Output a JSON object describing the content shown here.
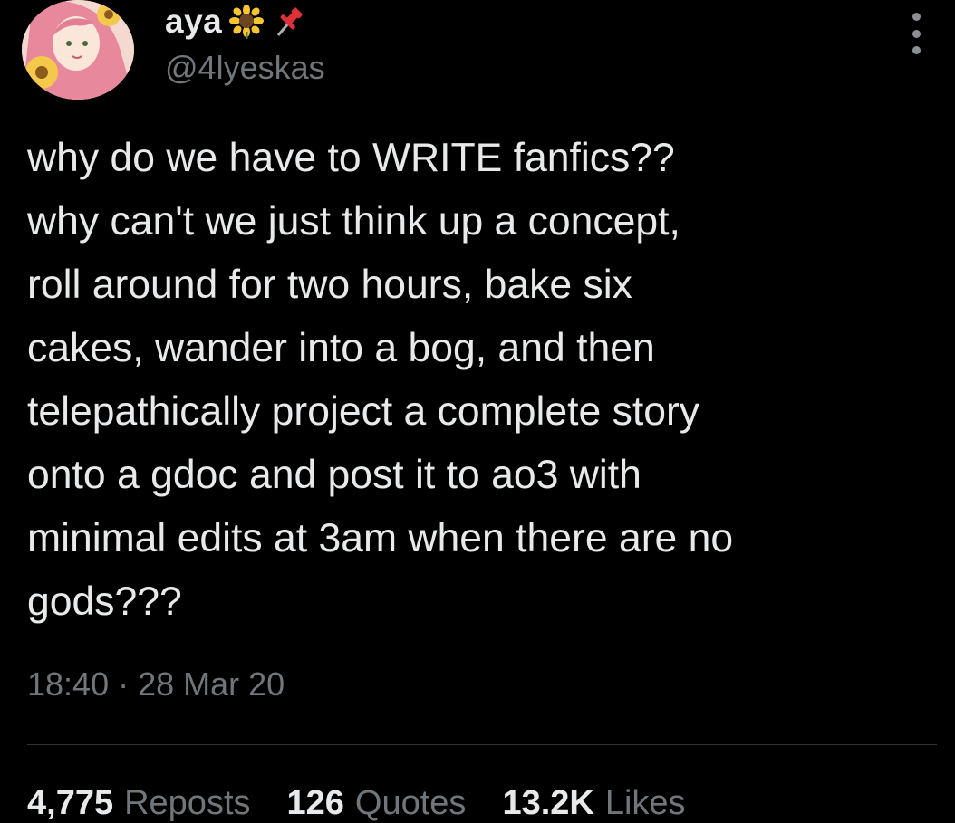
{
  "author": {
    "display_name": "aya",
    "handle": "@4lyeskas",
    "name_emojis": [
      "sunflower-emoji",
      "pushpin-emoji"
    ]
  },
  "tweet": {
    "text": "why do we have to WRITE fanfics??\nwhy can't we just think up a concept,\nroll around for two hours, bake six\ncakes, wander into a bog, and then\ntelepathically project a complete story\nonto a gdoc and post it to ao3 with\nminimal edits at 3am when there are no\ngods???",
    "time": "18:40",
    "separator": "·",
    "date": "28 Mar 20"
  },
  "stats": {
    "reposts": {
      "count": "4,775",
      "label": "Reposts"
    },
    "quotes": {
      "count": "126",
      "label": "Quotes"
    },
    "likes": {
      "count": "13.2K",
      "label": "Likes"
    }
  },
  "icons": {
    "more": "more-vertical-icon"
  },
  "colors": {
    "background": "#000000",
    "text": "#e7e9ea",
    "secondary": "#71767b",
    "divider": "#2f3336"
  }
}
